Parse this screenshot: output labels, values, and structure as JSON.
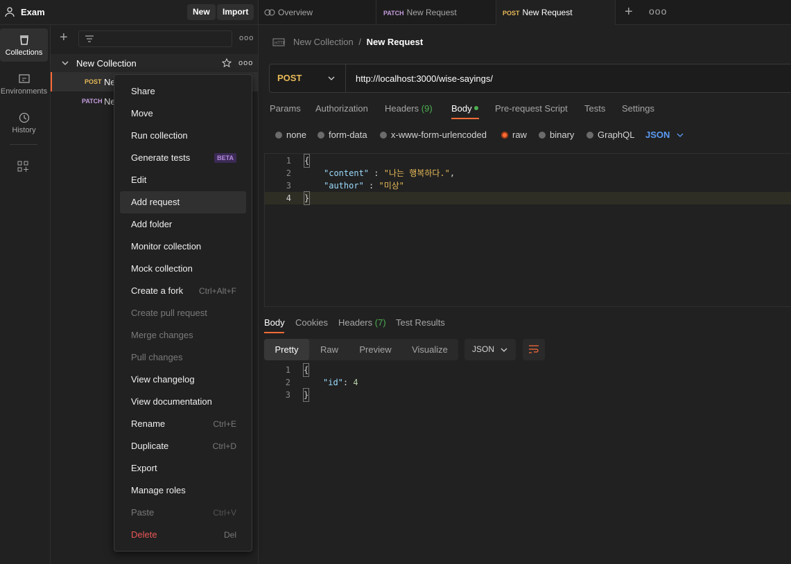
{
  "workspace": {
    "name": "Exam",
    "new_label": "New",
    "import_label": "Import"
  },
  "tabs": [
    {
      "label": "Overview"
    },
    {
      "method": "PATCH",
      "label": "New Request"
    },
    {
      "method": "POST",
      "label": "New Request"
    }
  ],
  "rail": {
    "collections": "Collections",
    "environments": "Environments",
    "history": "History"
  },
  "sidebar": {
    "collection_name": "New Collection",
    "requests": [
      {
        "method": "POST",
        "label": "Ne"
      },
      {
        "method": "PATCH",
        "label": "Ne"
      }
    ]
  },
  "menu": {
    "items": [
      {
        "label": "Share"
      },
      {
        "label": "Move"
      },
      {
        "label": "Run collection"
      },
      {
        "label": "Generate tests",
        "badge": "BETA"
      },
      {
        "label": "Edit"
      },
      {
        "label": "Add request"
      },
      {
        "label": "Add folder"
      },
      {
        "label": "Monitor collection"
      },
      {
        "label": "Mock collection"
      },
      {
        "label": "Create a fork",
        "shortcut": "Ctrl+Alt+F"
      },
      {
        "label": "Create pull request"
      },
      {
        "label": "Merge changes"
      },
      {
        "label": "Pull changes"
      },
      {
        "label": "View changelog"
      },
      {
        "label": "View documentation"
      },
      {
        "label": "Rename",
        "shortcut": "Ctrl+E"
      },
      {
        "label": "Duplicate",
        "shortcut": "Ctrl+D"
      },
      {
        "label": "Export"
      },
      {
        "label": "Manage roles"
      },
      {
        "label": "Paste",
        "shortcut": "Ctrl+V"
      },
      {
        "label": "Delete",
        "shortcut": "Del"
      }
    ]
  },
  "request": {
    "breadcrumb_collection": "New Collection",
    "breadcrumb_sep": "/",
    "breadcrumb_request": "New Request",
    "method": "POST",
    "url": "http://localhost:3000/wise-sayings/",
    "tabs": {
      "params": "Params",
      "authorization": "Authorization",
      "headers": "Headers",
      "headers_count": "(9)",
      "body": "Body",
      "prerequest": "Pre-request Script",
      "tests": "Tests",
      "settings": "Settings"
    },
    "body_modes": {
      "none": "none",
      "form_data": "form-data",
      "urlencoded": "x-www-form-urlencoded",
      "raw": "raw",
      "binary": "binary",
      "graphql": "GraphQL",
      "language": "JSON"
    },
    "body_lines": {
      "n1": "1",
      "n2": "2",
      "n3": "3",
      "n4": "4",
      "open": "{",
      "k1": "\"content\"",
      "colon1": " : ",
      "v1": "\"나는 행복하다.\"",
      "comma1": ",",
      "k2": "\"author\"",
      "colon2": " : ",
      "v2": "\"미상\"",
      "close": "}"
    }
  },
  "response": {
    "tabs": {
      "body": "Body",
      "cookies": "Cookies",
      "headers": "Headers",
      "headers_count": "(7)",
      "test_results": "Test Results"
    },
    "views": {
      "pretty": "Pretty",
      "raw": "Raw",
      "preview": "Preview",
      "visualize": "Visualize"
    },
    "format": "JSON",
    "lines": {
      "n1": "1",
      "n2": "2",
      "n3": "3",
      "open": "{",
      "key": "\"id\"",
      "colon": ": ",
      "value": "4",
      "close": "}"
    }
  }
}
